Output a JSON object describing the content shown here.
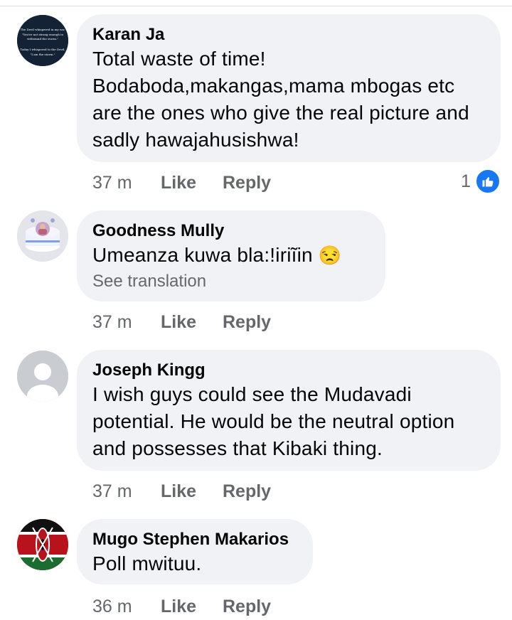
{
  "comments": [
    {
      "author": "Karan Ja",
      "lines": [
        "Total waste of time!",
        "Bodaboda,makangas,mama mbogas etc",
        "are the ones who give the real picture and",
        "sadly hawajahusishwa!"
      ],
      "time": "37 m",
      "like_label": "Like",
      "reply_label": "Reply",
      "reaction_count": "1",
      "avatar_text": [
        "The Devil whispered in my ear,",
        "\"You're not strong enough to",
        "withstand the storm.\"",
        "Today I whispered to the Devil,",
        "\"I am the storm.\""
      ]
    },
    {
      "author": "Goodness Mully",
      "lines": [
        "Umeanza kuwa bla:!iriĩin"
      ],
      "emoji": "😒",
      "translate_label": "See translation",
      "time": "37 m",
      "like_label": "Like",
      "reply_label": "Reply"
    },
    {
      "author": "Joseph Kingg",
      "lines": [
        "I wish guys could see the Mudavadi",
        "potential. He would be the neutral option",
        "and possesses that Kibaki thing."
      ],
      "time": "37 m",
      "like_label": "Like",
      "reply_label": "Reply"
    },
    {
      "author": "Mugo Stephen Makarios",
      "lines": [
        "Poll mwituu."
      ],
      "time": "36 m",
      "like_label": "Like",
      "reply_label": "Reply"
    }
  ],
  "colors": {
    "bubble": "#f0f2f5",
    "secondary_text": "#65676b",
    "like_blue": "#1877f2"
  }
}
